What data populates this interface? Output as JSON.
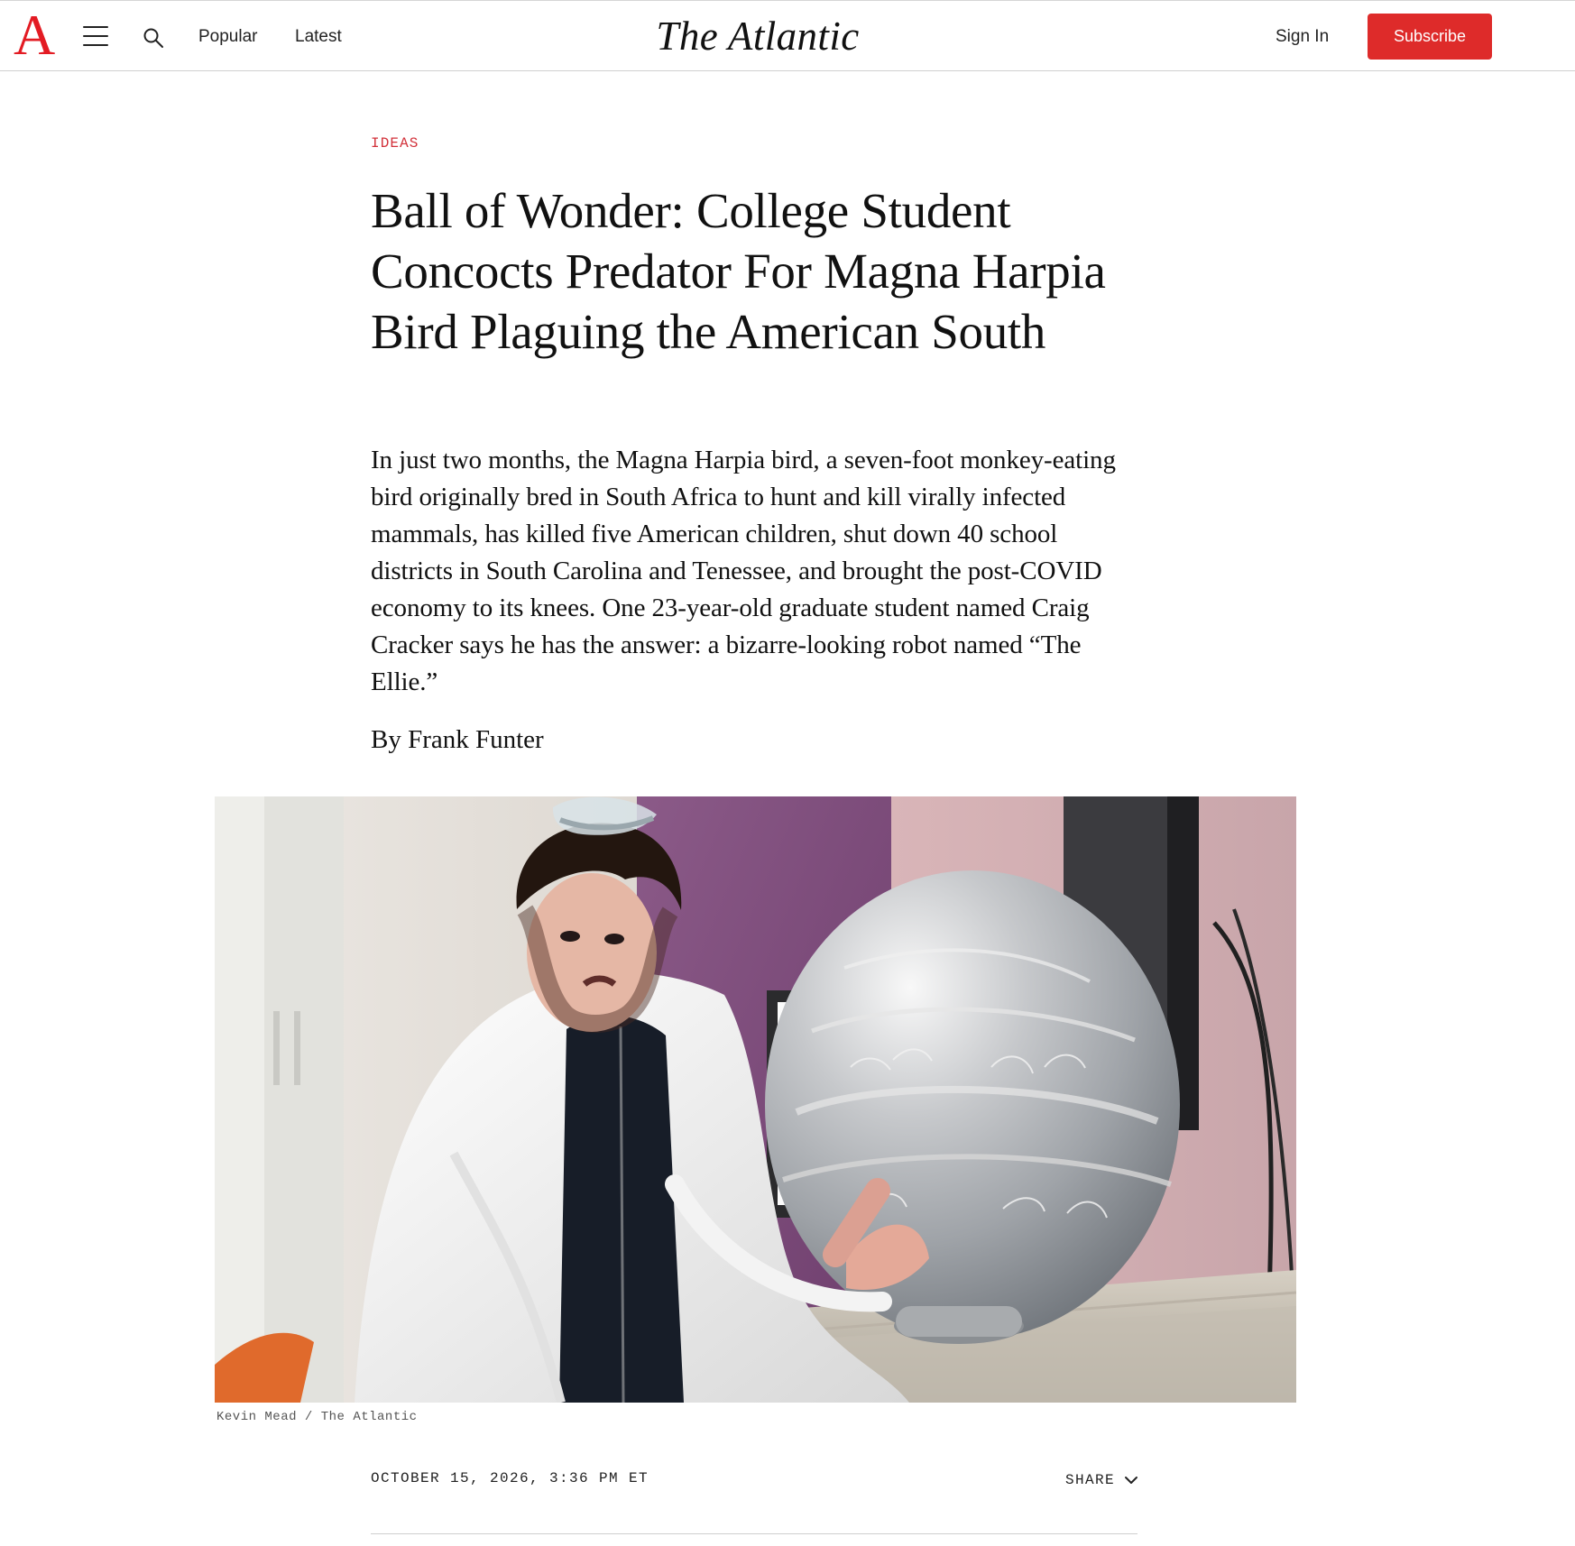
{
  "header": {
    "logo_letter": "A",
    "menu_icon": "menu-icon",
    "search_icon": "search-icon",
    "nav": [
      "Popular",
      "Latest"
    ],
    "site_title": "The Atlantic",
    "sign_in_label": "Sign In",
    "subscribe_label": "Subscribe"
  },
  "article": {
    "section": "IDEAS",
    "headline": "Ball of Wonder: College Student Concocts Predator For Magna Harpia Bird Plaguing the American South",
    "dek": "In just two months, the Magna Harpia bird, a seven-foot monkey-eating bird originally bred in South Africa to hunt and kill virally infected mammals, has killed five American children, shut down 40 school districts in South Carolina and Tenessee, and brought the post-COVID economy to its knees. One 23-year-old graduate student named Craig Cracker says he has the answer: a bizarre-looking robot named “The Ellie.”",
    "byline": "By Frank Funter",
    "photo_credit": "Kevin Mead / The Atlantic",
    "date": "OCTOBER 15, 2026, 3:36 PM ET",
    "share_label": "SHARE",
    "share_icon": "chevron-down-icon"
  },
  "colors": {
    "brand_red": "#e31b23",
    "subscribe_red": "#de2b2a",
    "section_red": "#d2313a"
  }
}
